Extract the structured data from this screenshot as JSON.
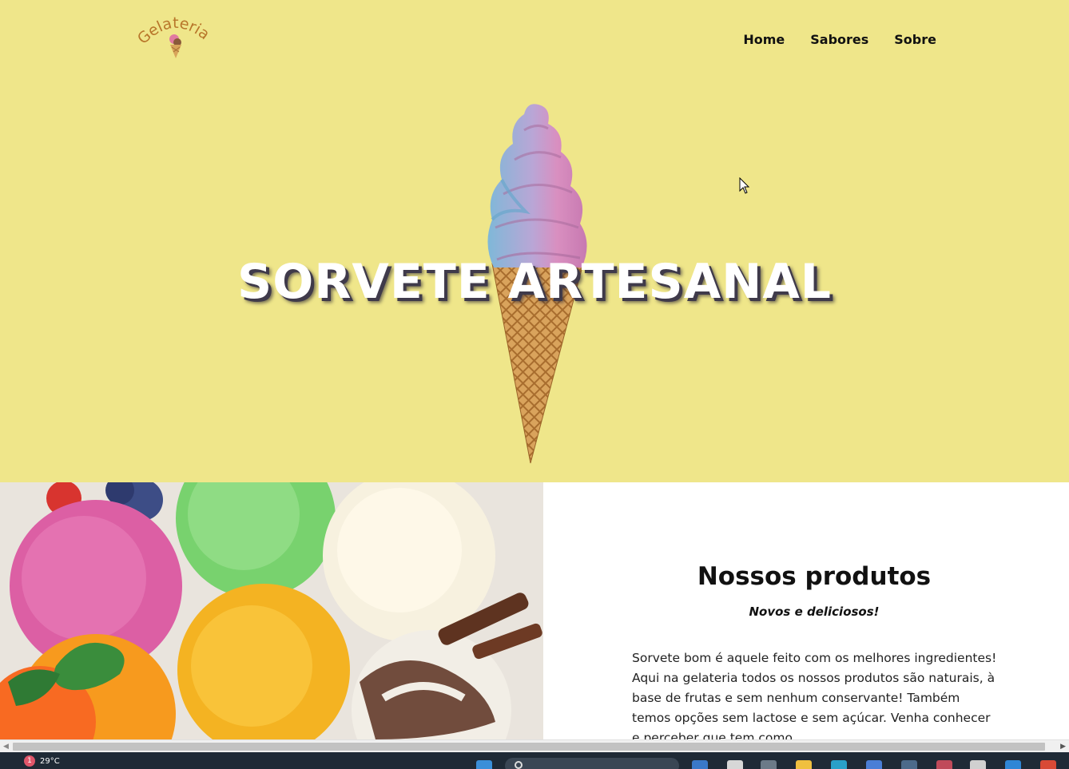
{
  "brand": {
    "logo_text": "Gelateria"
  },
  "nav": {
    "items": [
      "Home",
      "Sabores",
      "Sobre"
    ]
  },
  "hero": {
    "title": "SORVETE ARTESANAL"
  },
  "products": {
    "title": "Nossos produtos",
    "subtitle": "Novos e deliciosos!",
    "description": "Sorvete bom é aquele feito com os melhores ingredientes! Aqui na gelateria todos os nossos produtos são naturais, à base de frutas e sem nenhum conservante! Também temos opções sem lactose e sem açúcar. Venha conhecer e perceber que tem como"
  },
  "taskbar": {
    "notification_count": "1",
    "temperature": "29°C"
  },
  "colors": {
    "hero_background": "#efe68a",
    "logo": "#b8762a",
    "title_shadow": "#3f3a4a",
    "taskbar": "#1f2a36"
  },
  "icons": [
    "ice-cream-logo-icon",
    "mouse-cursor-icon",
    "scroll-left-arrow-icon",
    "scroll-right-arrow-icon",
    "windows-start-icon",
    "search-icon"
  ]
}
